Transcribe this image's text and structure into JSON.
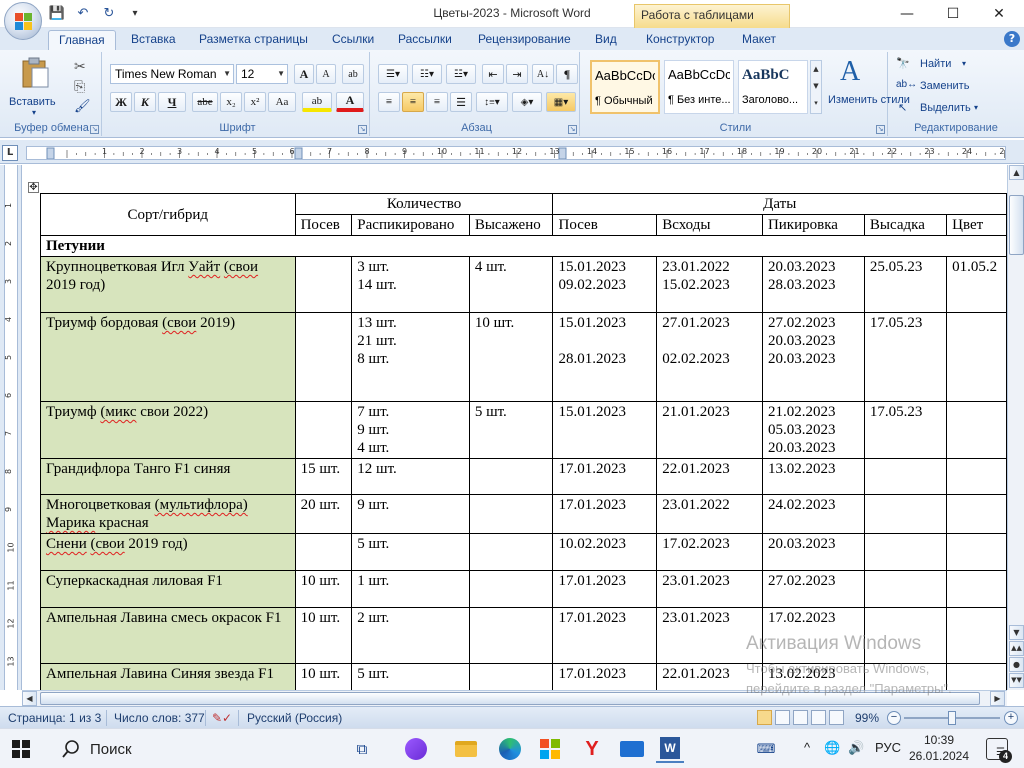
{
  "window": {
    "title": "Цветы-2023 - Microsoft Word",
    "context_tab_group": "Работа с таблицами",
    "controls": {
      "minimize": "—",
      "maximize": "☐",
      "close": "✕"
    }
  },
  "qat": {
    "save": "💾",
    "undo": "↶",
    "redo": "↻",
    "customize": "▾"
  },
  "tabs": [
    {
      "label": "Главная"
    },
    {
      "label": "Вставка"
    },
    {
      "label": "Разметка страницы"
    },
    {
      "label": "Ссылки"
    },
    {
      "label": "Рассылки"
    },
    {
      "label": "Рецензирование"
    },
    {
      "label": "Вид"
    },
    {
      "label": "Конструктор"
    },
    {
      "label": "Макет"
    }
  ],
  "help": "?",
  "ribbon": {
    "clipboard": {
      "label": "Буфер обмена",
      "paste": "Вставить",
      "paste_arrow": "▾",
      "cut": "✂",
      "copy": "⎘",
      "format_painter": "🖌"
    },
    "font": {
      "label": "Шрифт",
      "name": "Times New Roman",
      "size": "12",
      "grow": "A",
      "shrink": "A",
      "clear": "ab",
      "bold": "Ж",
      "italic": "К",
      "underline": "Ч",
      "strike": "abe",
      "subscript": "x₂",
      "superscript": "x²",
      "case": "Aa",
      "highlight": "ab",
      "color": "A"
    },
    "paragraph": {
      "label": "Абзац",
      "show_marks": "¶",
      "sort": "A↓"
    },
    "styles": {
      "label": "Стили",
      "items": [
        {
          "sample": "AaBbCcDc",
          "name": "¶ Обычный"
        },
        {
          "sample": "AaBbCcDc",
          "name": "¶ Без инте..."
        },
        {
          "sample": "AaBbC",
          "name": "Заголово..."
        }
      ],
      "change": "Изменить стили",
      "change_arrow": "▾"
    },
    "editing": {
      "label": "Редактирование",
      "find": "Найти",
      "replace": "Заменить",
      "select": "Выделить"
    }
  },
  "ruler": {
    "toggle": "L",
    "numbers": [
      "1",
      "2",
      "3",
      "4",
      "5",
      "6",
      "7",
      "8",
      "9",
      "10",
      "11",
      "12",
      "13",
      "14",
      "15",
      "16",
      "17",
      "18",
      "19",
      "20",
      "21",
      "22",
      "23",
      "24",
      "25"
    ]
  },
  "vruler": {
    "numbers": [
      "1",
      "2",
      "3",
      "4",
      "5",
      "6",
      "7",
      "8",
      "9",
      "10",
      "11",
      "12",
      "13"
    ]
  },
  "table": {
    "move_handle": "✥",
    "header": {
      "variety": "Сорт/гибрид",
      "quantity": "Количество",
      "dates": "Даты",
      "q_cols": [
        "Посев",
        "Распикировано",
        "Высажено"
      ],
      "d_cols": [
        "Посев",
        "Всходы",
        "Пикировка",
        "Высадка",
        "Цвет"
      ]
    },
    "section": "Петунии",
    "rows": [
      {
        "name": "Крупноцветковая  Игл Уайт (свои 2019 год)",
        "sow_qty": "",
        "picked": [
          "3 шт.",
          "14 шт."
        ],
        "planted": "4 шт.",
        "sow_date": [
          "15.01.2023",
          "09.02.2023"
        ],
        "sprout": [
          "23.01.2022",
          "15.02.2023"
        ],
        "pick": [
          "20.03.2023",
          "28.03.2023"
        ],
        "plant_date": "25.05.23",
        "bloom": "01.05.2"
      },
      {
        "name": "Триумф бордовая (свои 2019)",
        "sow_qty": "",
        "picked": [
          "13 шт.",
          "21 шт.",
          "8 шт."
        ],
        "planted": "10 шт.",
        "sow_date": [
          "15.01.2023",
          "",
          "28.01.2023"
        ],
        "sprout": [
          "27.01.2023",
          "",
          "02.02.2023"
        ],
        "pick": [
          "27.02.2023",
          "20.03.2023",
          "20.03.2023"
        ],
        "plant_date": "17.05.23",
        "bloom": ""
      },
      {
        "name": "Триумф (микс свои 2022)",
        "sow_qty": "",
        "picked": [
          "7 шт.",
          "9 шт.",
          "4 шт."
        ],
        "planted": "5 шт.",
        "sow_date": [
          "15.01.2023"
        ],
        "sprout": [
          "21.01.2023"
        ],
        "pick": [
          "21.02.2023",
          "05.03.2023",
          "20.03.2023"
        ],
        "plant_date": "17.05.23",
        "bloom": ""
      },
      {
        "name": "Грандифлора Танго F1 синяя",
        "sow_qty": "15 шт.",
        "picked": [
          "12 шт."
        ],
        "planted": "",
        "sow_date": [
          "17.01.2023"
        ],
        "sprout": [
          "22.01.2023"
        ],
        "pick": [
          "13.02.2023"
        ],
        "plant_date": "",
        "bloom": ""
      },
      {
        "name": "Многоцветковая (мультифлора) Марика  красная",
        "sow_qty": "20 шт.",
        "picked": [
          "9 шт."
        ],
        "planted": "",
        "sow_date": [
          "17.01.2023"
        ],
        "sprout": [
          "23.01.2022"
        ],
        "pick": [
          "24.02.2023"
        ],
        "plant_date": "",
        "bloom": ""
      },
      {
        "name": "Снени (свои 2019 год)",
        "sow_qty": "",
        "picked": [
          "5 шт."
        ],
        "planted": "",
        "sow_date": [
          "10.02.2023"
        ],
        "sprout": [
          "17.02.2023"
        ],
        "pick": [
          "20.03.2023"
        ],
        "plant_date": "",
        "bloom": ""
      },
      {
        "name": "Суперкаскадная лиловая F1",
        "sow_qty": "10 шт.",
        "picked": [
          "1 шт."
        ],
        "planted": "",
        "sow_date": [
          "17.01.2023"
        ],
        "sprout": [
          "23.01.2023"
        ],
        "pick": [
          "27.02.2023"
        ],
        "plant_date": "",
        "bloom": ""
      },
      {
        "name": "Ампельная Лавина смесь окрасок F1",
        "sow_qty": "10 шт.",
        "picked": [
          "2 шт."
        ],
        "planted": "",
        "sow_date": [
          "17.01.2023"
        ],
        "sprout": [
          "23.01.2023"
        ],
        "pick": [
          "17.02.2023"
        ],
        "plant_date": "",
        "bloom": ""
      },
      {
        "name": "Ампельная Лавина Синяя звезда F1",
        "sow_qty": "10 шт.",
        "picked": [
          "5 шт."
        ],
        "planted": "",
        "sow_date": [
          "17.01.2023"
        ],
        "sprout": [
          "22.01.2023"
        ],
        "pick": [
          "13.02.2023"
        ],
        "plant_date": "",
        "bloom": ""
      }
    ]
  },
  "watermark": {
    "title": "Активация Windows",
    "line1": "Чтобы активировать Windows,",
    "line2": "перейдите в раздел \"Параметры\"."
  },
  "status": {
    "page": "Страница: 1 из 3",
    "words": "Число слов: 377",
    "language": "Русский (Россия)",
    "zoom": "99%",
    "zoom_out": "−",
    "zoom_in": "+",
    "zoom_level": 0.5
  },
  "taskbar": {
    "search": "Поиск",
    "language": "РУС",
    "time": "10:39",
    "date": "26.01.2024",
    "notifications": "4",
    "tray_up": "^",
    "volume": "🔊"
  }
}
